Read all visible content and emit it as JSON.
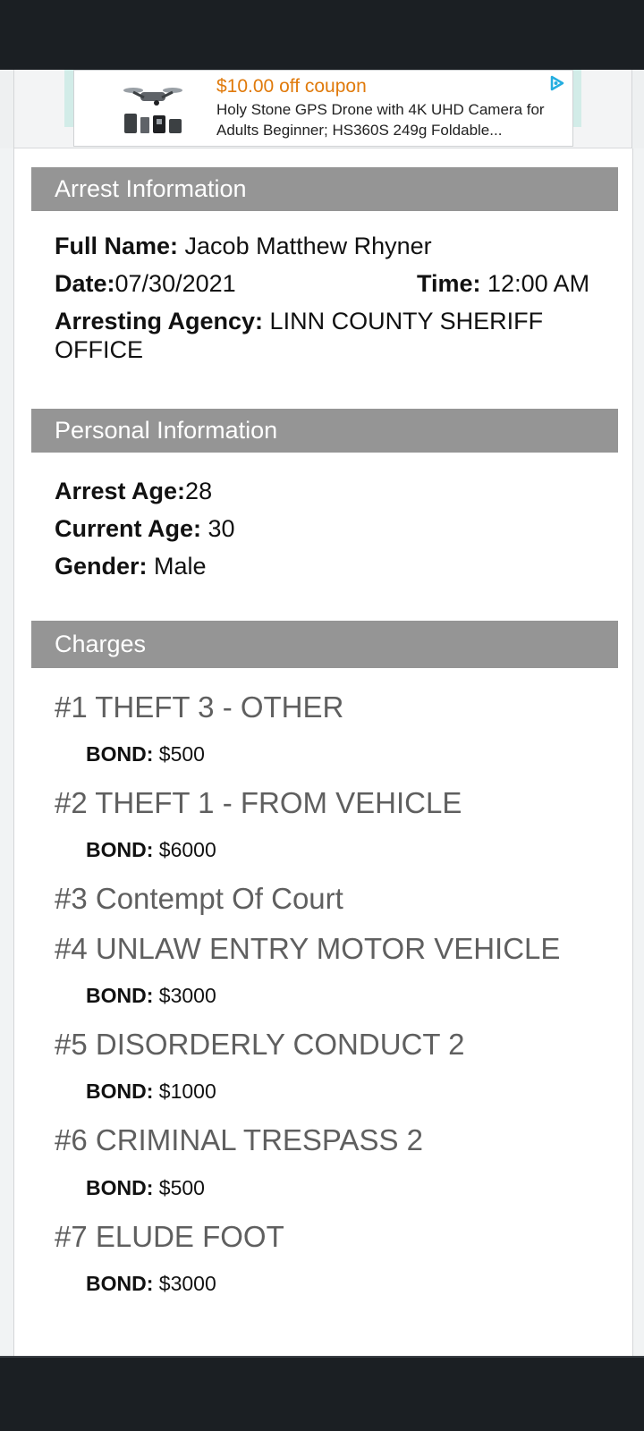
{
  "ad": {
    "coupon": "$10.00 off coupon",
    "title": "Holy Stone GPS Drone with 4K UHD Camera for Adults Beginner; HS360S 249g Foldable...",
    "thumb_icon": "drone-product-image",
    "choice_icon": "adchoices-icon",
    "coupon_color": "#e07a0b"
  },
  "arrest": {
    "header": "Arrest Information",
    "full_name_label": "Full Name:",
    "full_name": " Jacob Matthew Rhyner",
    "date_label": "Date:",
    "date": "07/30/2021",
    "time_label": "Time:",
    "time": " 12:00 AM",
    "agency_label": "Arresting Agency:",
    "agency": " LINN COUNTY SHERIFF OFFICE"
  },
  "personal": {
    "header": "Personal Information",
    "arrest_age_label": "Arrest Age:",
    "arrest_age": "28",
    "current_age_label": "Current Age:",
    "current_age": " 30",
    "gender_label": "Gender:",
    "gender": " Male"
  },
  "charges": {
    "header": "Charges",
    "bond_label": "BOND:",
    "items": [
      {
        "title": "#1 THEFT 3 - OTHER",
        "bond": " $500"
      },
      {
        "title": "#2 THEFT 1 - FROM VEHICLE",
        "bond": " $6000"
      },
      {
        "title": "#3 Contempt Of Court",
        "bond": null
      },
      {
        "title": "#4 UNLAW ENTRY MOTOR VEHICLE",
        "bond": " $3000"
      },
      {
        "title": "#5 DISORDERLY CONDUCT 2",
        "bond": " $1000"
      },
      {
        "title": "#6 CRIMINAL TRESPASS 2",
        "bond": " $500"
      },
      {
        "title": "#7 ELUDE FOOT",
        "bond": " $3000"
      }
    ]
  },
  "colors": {
    "section_header_bg": "#959595",
    "charge_text": "#5f5f5f",
    "system_bars": "#1b1f23"
  }
}
